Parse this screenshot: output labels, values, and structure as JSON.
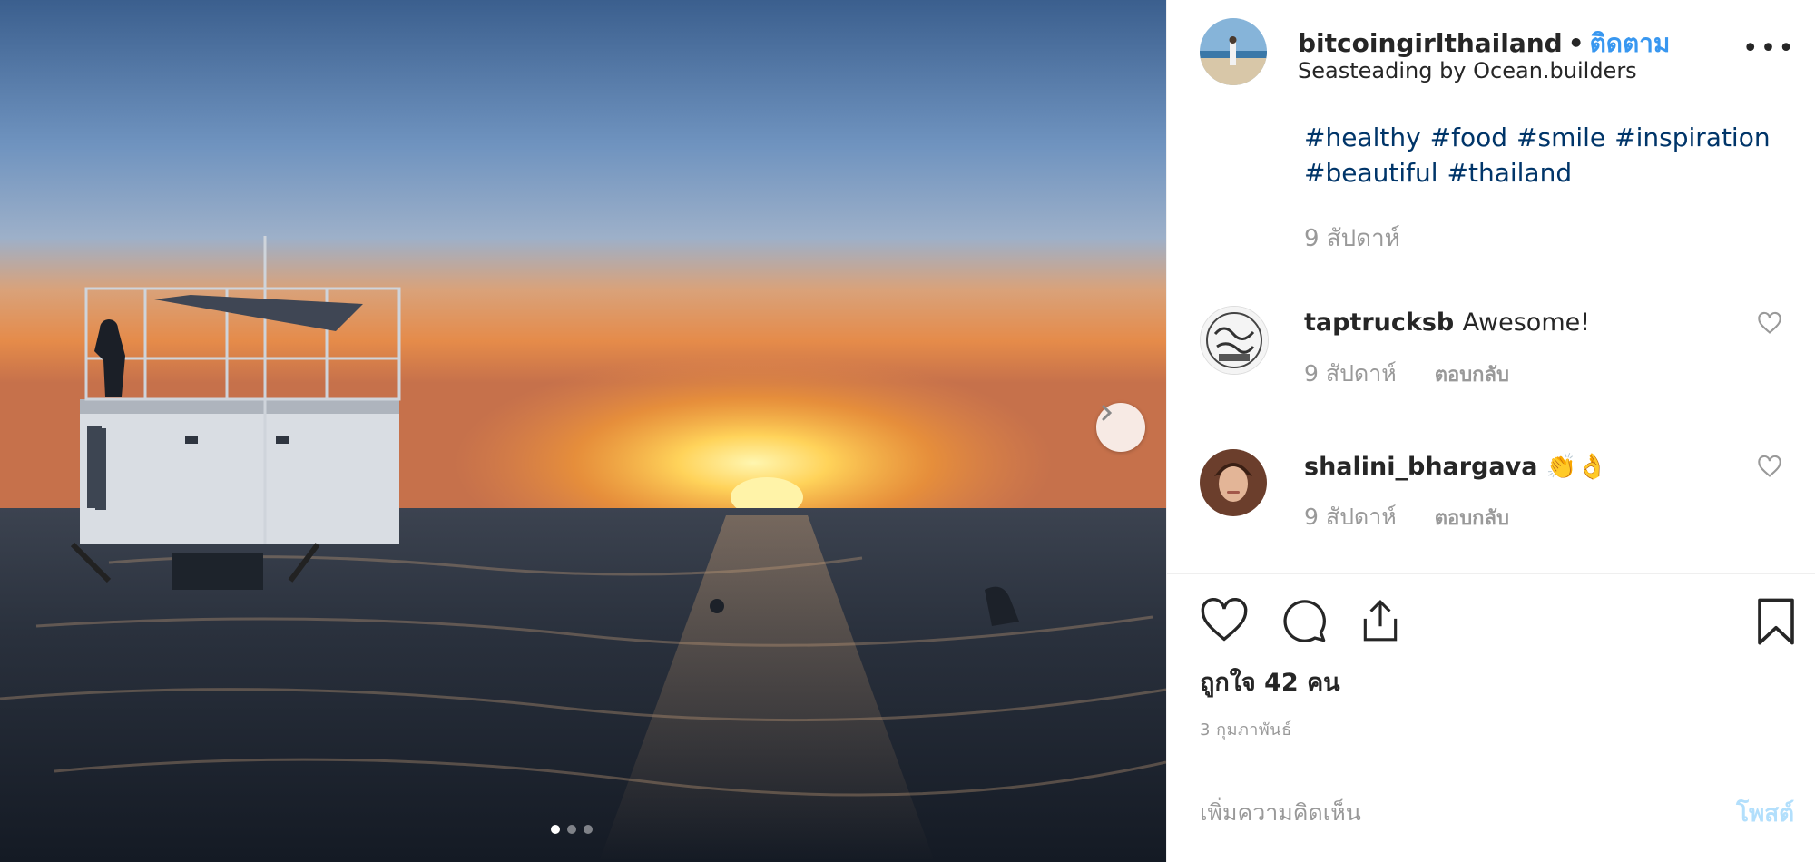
{
  "post": {
    "username": "bitcoingirlthailand",
    "separator": "•",
    "follow_label": "ติดตาม",
    "location": "Seasteading by Ocean.builders",
    "more_label": "•••"
  },
  "caption": {
    "hashtags": [
      "#healthy",
      "#food",
      "#smile",
      "#inspiration",
      "#beautiful",
      "#thailand"
    ],
    "time": "9 สัปดาห์"
  },
  "comments": [
    {
      "user": "taptrucksb",
      "text": "Awesome!",
      "time": "9 สัปดาห์",
      "reply_label": "ตอบกลับ"
    },
    {
      "user": "shalini_bhargava",
      "text": "👏👌",
      "time": "9 สัปดาห์",
      "reply_label": "ตอบกลับ"
    }
  ],
  "likes_text": "ถูกใจ 42 คน",
  "date_text": "3 กุมภาพันธ์",
  "composer": {
    "placeholder": "เพิ่มความคิดเห็น",
    "post_label": "โพสต์"
  },
  "carousel": {
    "count": 3,
    "active": 1
  },
  "colors": {
    "link_blue": "#3897f0",
    "hashtag": "#003569",
    "muted": "#999999",
    "post_disabled": "#b2dffc"
  },
  "icons": [
    "chevron-right-icon",
    "heart-icon",
    "comment-icon",
    "share-icon",
    "bookmark-icon",
    "more-icon"
  ]
}
